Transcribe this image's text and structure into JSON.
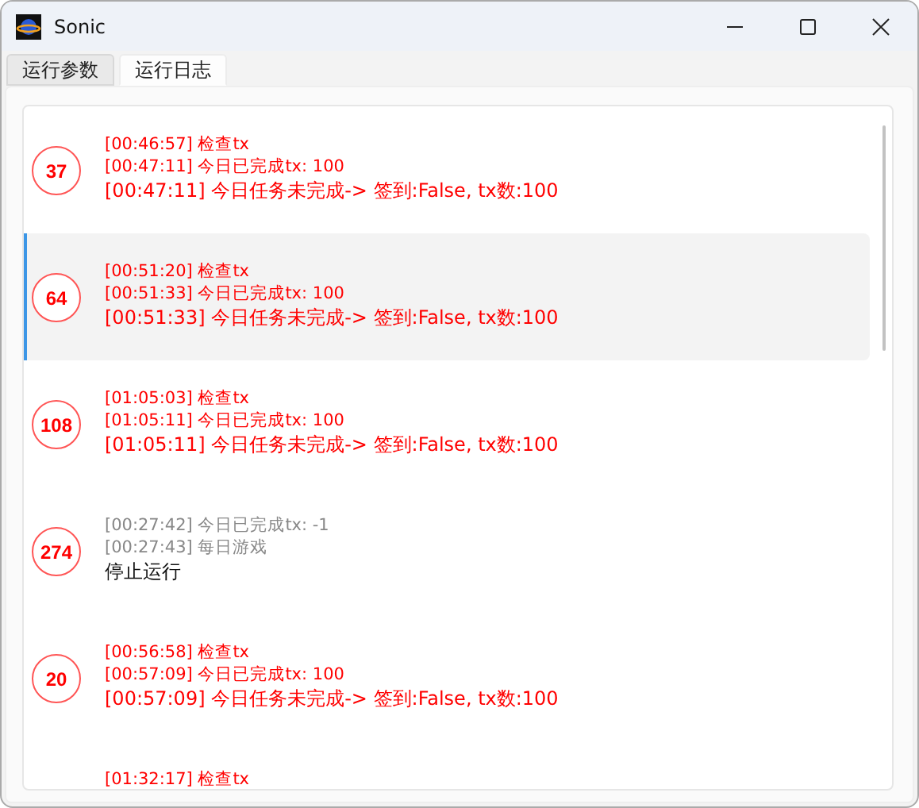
{
  "window": {
    "title": "Sonic"
  },
  "tabs": [
    {
      "label": "运行参数",
      "selected": false
    },
    {
      "label": "运行日志",
      "selected": true
    }
  ],
  "log_entries": [
    {
      "count": "37",
      "selected": false,
      "lines": [
        {
          "kind": "detail",
          "text": "[00:46:57] 检查tx"
        },
        {
          "kind": "detail",
          "text": "[00:47:11] 今日已完成tx: 100"
        },
        {
          "kind": "result",
          "text": "[00:47:11] 今日任务未完成-> 签到:False, tx数:100"
        }
      ]
    },
    {
      "count": "64",
      "selected": true,
      "lines": [
        {
          "kind": "detail",
          "text": "[00:51:20] 检查tx"
        },
        {
          "kind": "detail",
          "text": "[00:51:33] 今日已完成tx: 100"
        },
        {
          "kind": "result",
          "text": "[00:51:33] 今日任务未完成-> 签到:False, tx数:100"
        }
      ]
    },
    {
      "count": "108",
      "selected": false,
      "lines": [
        {
          "kind": "detail",
          "text": "[01:05:03] 检查tx"
        },
        {
          "kind": "detail",
          "text": "[01:05:11] 今日已完成tx: 100"
        },
        {
          "kind": "result",
          "text": "[01:05:11] 今日任务未完成-> 签到:False, tx数:100"
        }
      ]
    },
    {
      "count": "274",
      "selected": false,
      "lines": [
        {
          "kind": "muted",
          "text": "[00:27:42] 今日已完成tx: -1"
        },
        {
          "kind": "muted",
          "text": "[00:27:43] 每日游戏"
        },
        {
          "kind": "plain",
          "text": "停止运行"
        }
      ]
    },
    {
      "count": "20",
      "selected": false,
      "lines": [
        {
          "kind": "detail",
          "text": "[00:56:58] 检查tx"
        },
        {
          "kind": "detail",
          "text": "[00:57:09] 今日已完成tx: 100"
        },
        {
          "kind": "result",
          "text": "[00:57:09] 今日任务未完成-> 签到:False, tx数:100"
        }
      ]
    },
    {
      "selected": false,
      "lines": [
        {
          "kind": "detail",
          "text": "[01:32:17] 检查tx"
        }
      ]
    }
  ]
}
